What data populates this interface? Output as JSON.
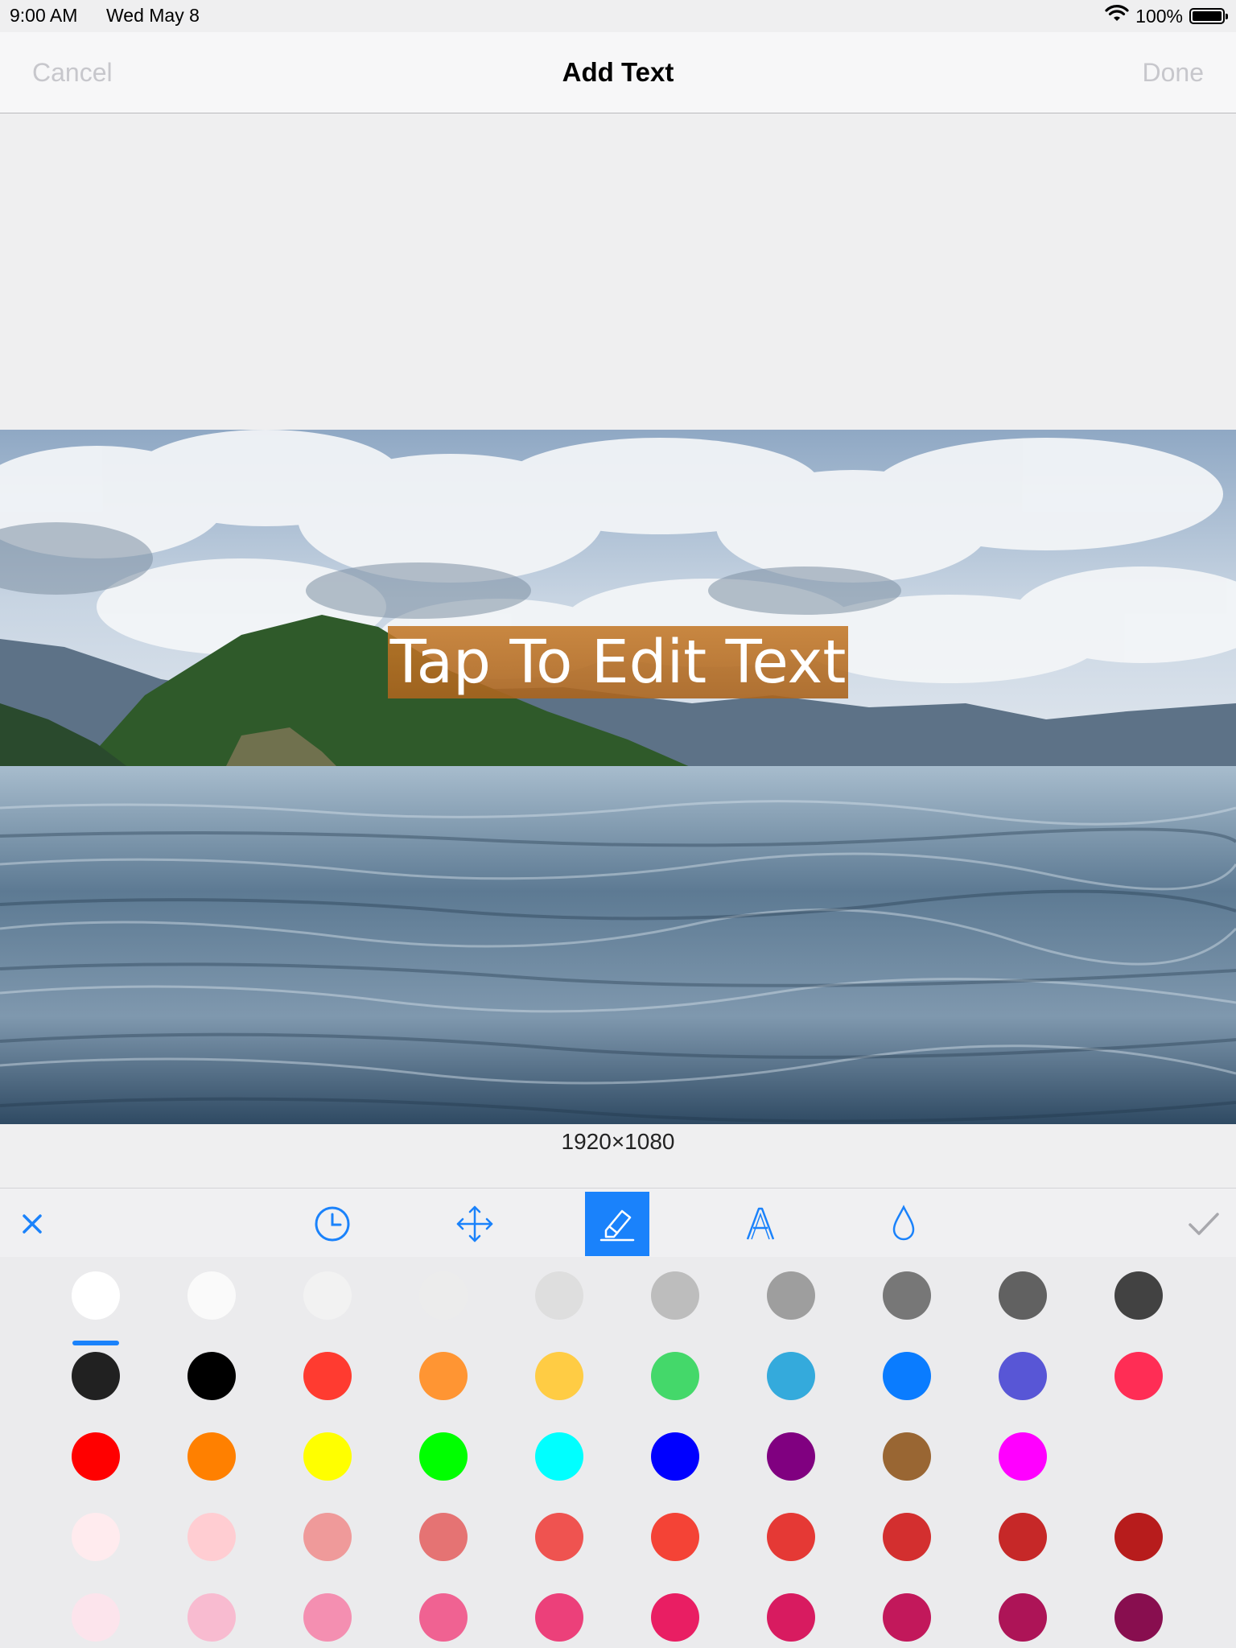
{
  "status_bar": {
    "time": "9:00 AM",
    "date": "Wed May 8",
    "battery_text": "100%",
    "battery_level": 1.0
  },
  "nav": {
    "cancel_label": "Cancel",
    "title": "Add Text",
    "done_label": "Done"
  },
  "canvas": {
    "overlay_text": "Tap To Edit Text",
    "size_text": "1920×1080"
  },
  "toolbar": {
    "tools": [
      {
        "name": "close-icon",
        "active": false
      },
      {
        "name": "clock-icon",
        "active": false
      },
      {
        "name": "move-arrows-icon",
        "active": false
      },
      {
        "name": "highlighter-icon",
        "active": true
      },
      {
        "name": "font-a-icon",
        "active": false
      },
      {
        "name": "opacity-drop-icon",
        "active": false
      },
      {
        "name": "checkmark-icon",
        "active": false
      }
    ],
    "accent_color": "#1a82fb"
  },
  "palette": {
    "selected_index": 0,
    "rows": [
      [
        "#ffffff",
        "#fafafa",
        "#f2f2f2",
        "#ececec",
        "#dedede",
        "#bdbdbd",
        "#9e9e9e",
        "#777777",
        "#616161",
        "#424242"
      ],
      [
        "#212121",
        "#000000",
        "#ff3b30",
        "#ff9533",
        "#ffcc44",
        "#44d86a",
        "#34aadc",
        "#0a7cff",
        "#5856d6",
        "#ff2d55"
      ],
      [
        "#ff0000",
        "#ff8000",
        "#ffff00",
        "#00ff00",
        "#00ffff",
        "#0000ff",
        "#800080",
        "#996633",
        "#ff00ff",
        null
      ],
      [
        "#ffebee",
        "#ffcdd2",
        "#ef9a9a",
        "#e57373",
        "#ef5350",
        "#f44336",
        "#e53935",
        "#d32f2f",
        "#c62828",
        "#b71c1c"
      ],
      [
        "#fce4ec",
        "#f8bbd0",
        "#f48fb1",
        "#f06292",
        "#ec407a",
        "#e91e63",
        "#d81b60",
        "#c2185b",
        "#ad1457",
        "#880e4f"
      ]
    ]
  }
}
